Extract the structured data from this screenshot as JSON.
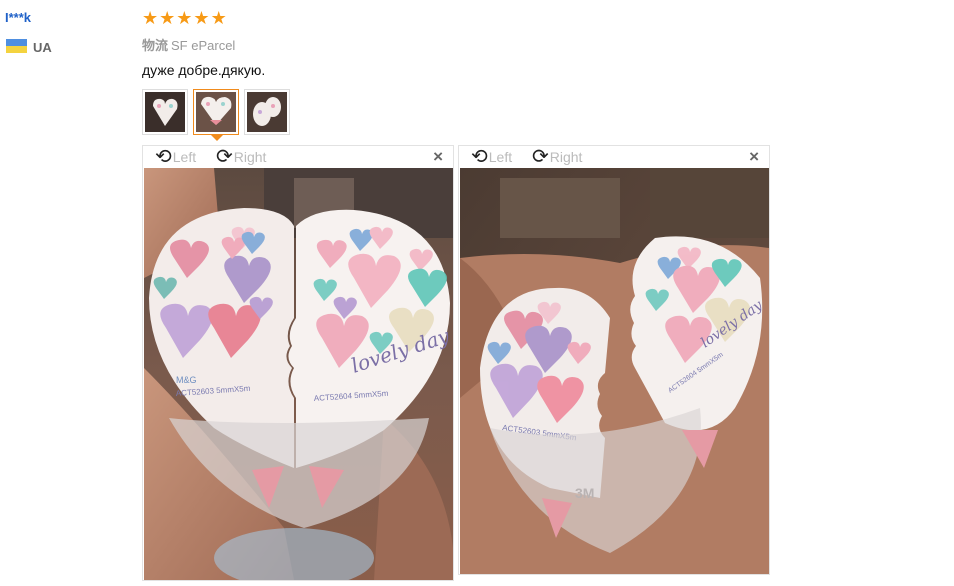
{
  "user": {
    "name": "I***k",
    "country": "UA"
  },
  "review": {
    "rating": 5,
    "stars": [
      "★",
      "★",
      "★",
      "★",
      "★"
    ],
    "shipping_label": "物流",
    "shipping_value": "SF eParcel",
    "text": "дуже добре.дякую."
  },
  "viewer": {
    "rotate_left_icon": "⟲",
    "rotate_left_label": "Left",
    "rotate_right_icon": "⟳",
    "rotate_right_label": "Right",
    "close_label": "×"
  },
  "colors": {
    "star": "#f79a16",
    "user_link": "#1f61c8",
    "active_thumb": "#f08b1d"
  },
  "photos": {
    "photo1": {
      "product_text": "ACT52603 5mmX5m",
      "product_text2": "ACT52604 5mmX5m",
      "brand": "M&G",
      "script": "lovely day"
    },
    "photo2": {
      "product_text": "ACT52603 5mmX5m",
      "product_text2": "ACT52604 5mmX5m",
      "brand": "3M"
    }
  }
}
